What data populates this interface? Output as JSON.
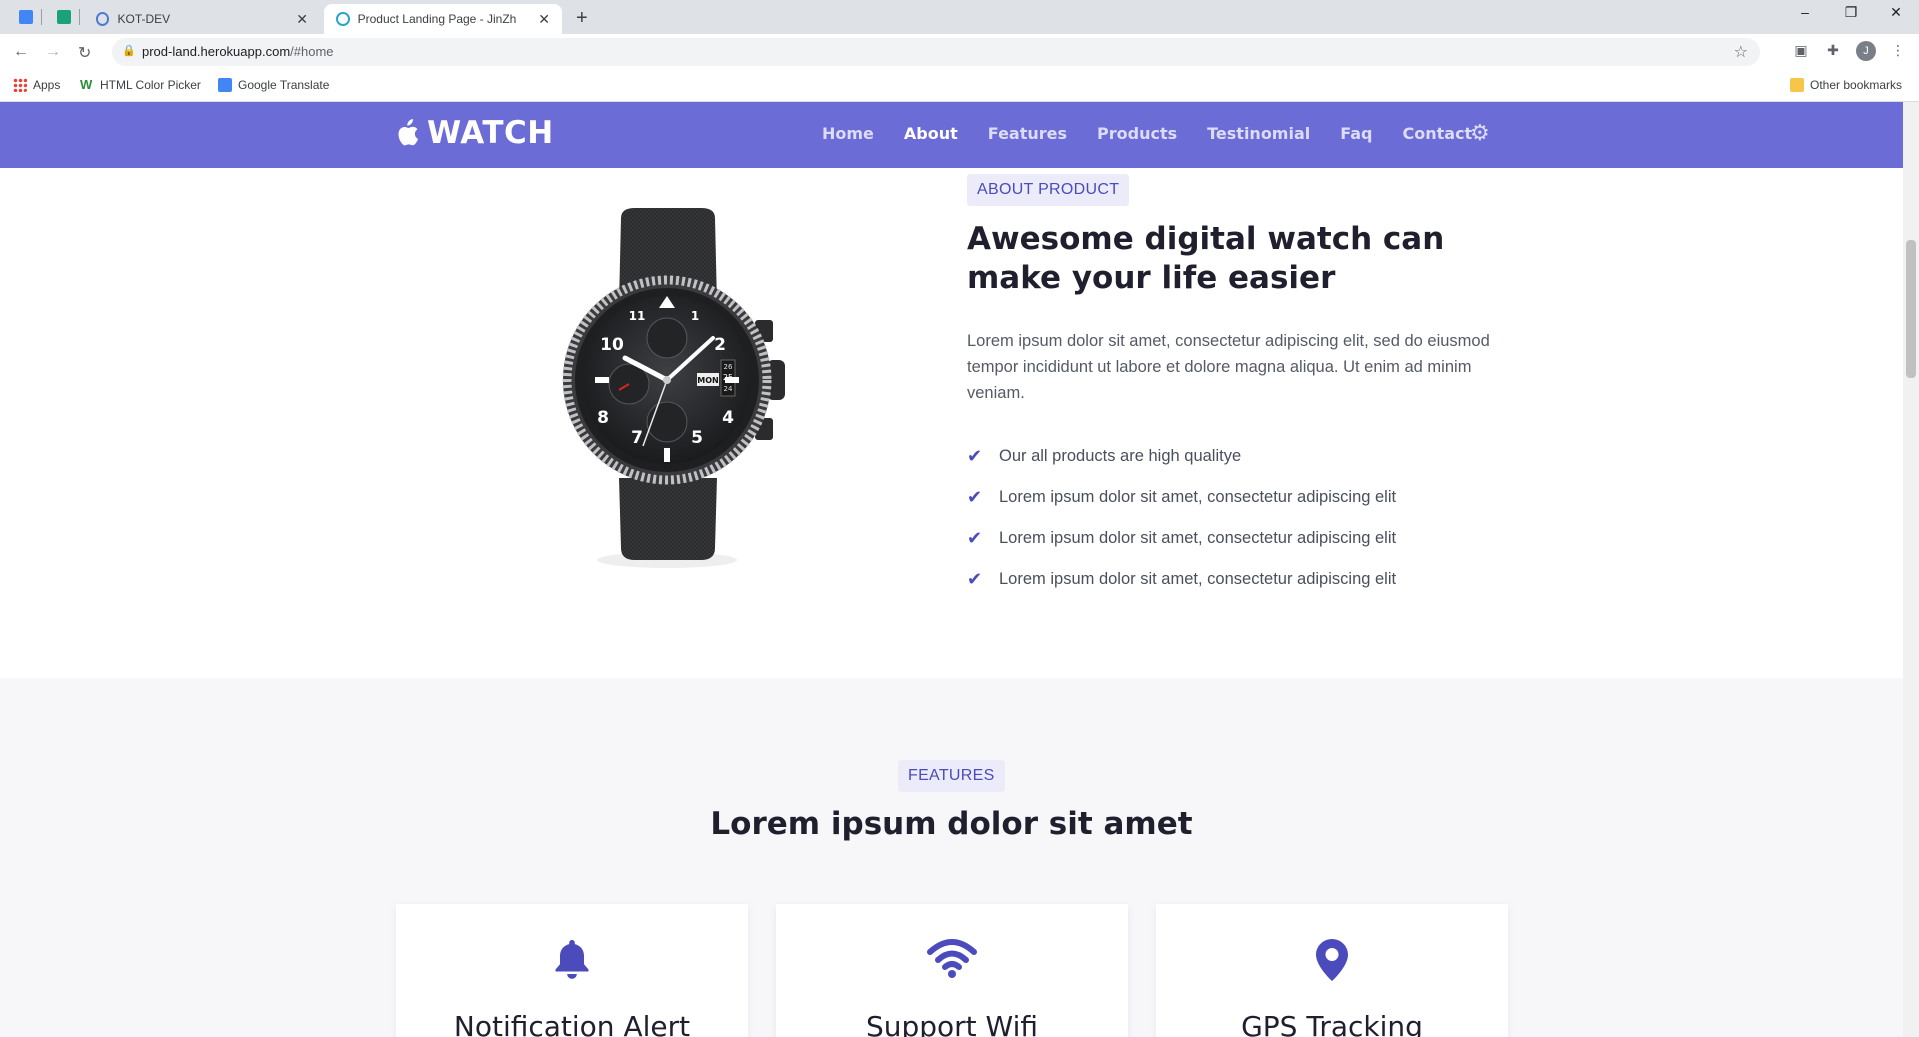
{
  "browser": {
    "tabs": [
      {
        "title": "KOT-DEV"
      },
      {
        "title": "Product Landing Page - JinZh",
        "active": true
      }
    ],
    "new_tab": "+",
    "window_controls": {
      "minimize": "–",
      "restore": "❐",
      "close": "✕"
    },
    "nav_icons": {
      "back": "←",
      "forward": "→",
      "reload": "↻"
    },
    "url": {
      "host": "prod-land.herokuapp.com",
      "path": "/#home"
    },
    "profile_initial": "J",
    "bookmarks": [
      {
        "label": "Apps",
        "icon": "apps-grid-icon"
      },
      {
        "label": "HTML Color Picker",
        "icon": "w-logo-icon"
      },
      {
        "label": "Google Translate",
        "icon": "translate-icon"
      }
    ],
    "other_bookmarks": "Other bookmarks"
  },
  "site": {
    "brand": "WATCH",
    "brand_icon": "",
    "nav": [
      "Home",
      "About",
      "Features",
      "Products",
      "Testinomial",
      "Faq",
      "Contact"
    ],
    "active_nav": "About",
    "settings_icon": "⚙"
  },
  "about": {
    "tag": "ABOUT PRODUCT",
    "title": "Awesome digital watch can make your life easier",
    "text": "Lorem ipsum dolor sit amet, consectetur adipiscing elit, sed do eiusmod tempor incididunt ut labore et dolore magna aliqua. Ut enim ad minim veniam.",
    "check_icon": "✔",
    "points": [
      "Our all products are high qualitye",
      "Lorem ipsum dolor sit amet, consectetur adipiscing elit",
      "Lorem ipsum dolor sit amet, consectetur adipiscing elit",
      "Lorem ipsum dolor sit amet, consectetur adipiscing elit"
    ],
    "watch_date": {
      "day": "MON",
      "numbers": [
        "26",
        "25",
        "24"
      ]
    },
    "dial_numbers": [
      "10",
      "2",
      "8",
      "4",
      "7",
      "5",
      "1",
      "11"
    ]
  },
  "features": {
    "tag": "FEATURES",
    "title": "Lorem ipsum dolor sit amet",
    "cards": [
      {
        "title": "Notification Alert",
        "icon": "bell-icon"
      },
      {
        "title": "Support Wifi",
        "icon": "wifi-icon"
      },
      {
        "title": "GPS Tracking",
        "icon": "map-pin-icon"
      }
    ]
  },
  "colors": {
    "accent": "#6c6cd6",
    "icon": "#4b4bbb",
    "tag_bg": "#ebebfa"
  }
}
